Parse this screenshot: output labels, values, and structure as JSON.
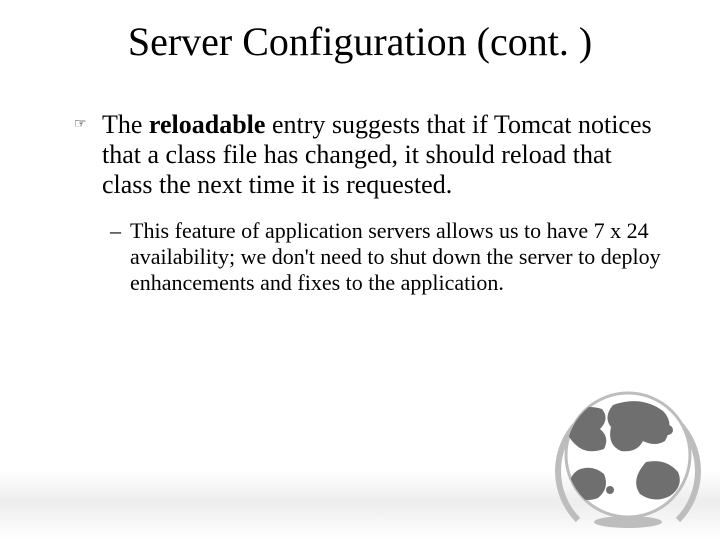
{
  "title": "Server Configuration (cont. )",
  "bullet": {
    "icon": "☞",
    "prefix": "The ",
    "bold": "reloadable",
    "suffix": " entry suggests that if Tomcat notices that a class file has changed, it should reload that class the next time it is requested."
  },
  "sub": {
    "dash": "–",
    "text": "This feature of application servers allows us to have 7 x 24 availability; we don't need to shut down the server to deploy enhancements and fixes to the application."
  }
}
